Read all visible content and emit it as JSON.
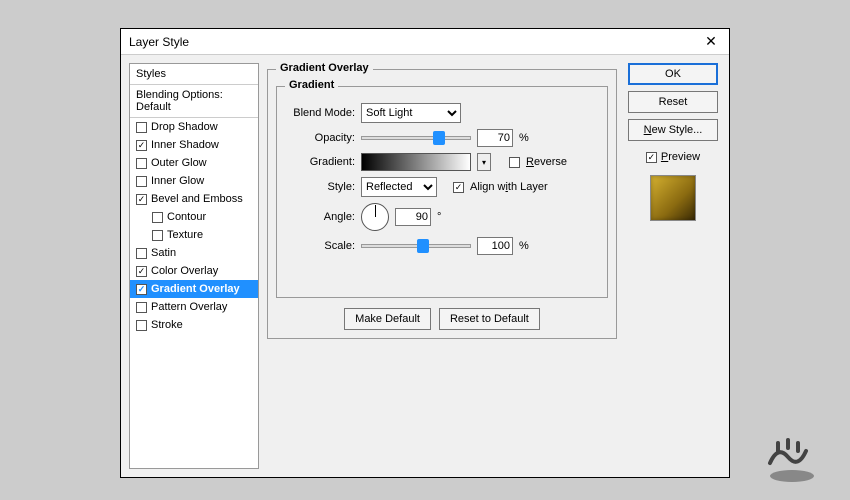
{
  "dialog": {
    "title": "Layer Style"
  },
  "styles": {
    "header": "Styles",
    "blending": "Blending Options: Default",
    "items": [
      {
        "label": "Drop Shadow",
        "checked": false
      },
      {
        "label": "Inner Shadow",
        "checked": true
      },
      {
        "label": "Outer Glow",
        "checked": false
      },
      {
        "label": "Inner Glow",
        "checked": false
      },
      {
        "label": "Bevel and Emboss",
        "checked": true
      },
      {
        "label": "Contour",
        "checked": false,
        "sub": true
      },
      {
        "label": "Texture",
        "checked": false,
        "sub": true
      },
      {
        "label": "Satin",
        "checked": false
      },
      {
        "label": "Color Overlay",
        "checked": true
      },
      {
        "label": "Gradient Overlay",
        "checked": true,
        "selected": true
      },
      {
        "label": "Pattern Overlay",
        "checked": false
      },
      {
        "label": "Stroke",
        "checked": false
      }
    ]
  },
  "gradient": {
    "group_title": "Gradient Overlay",
    "inner_title": "Gradient",
    "blend_mode_label": "Blend Mode:",
    "blend_mode_value": "Soft Light",
    "opacity_label": "Opacity:",
    "opacity_value": "70",
    "opacity_pct": 70,
    "percent": "%",
    "gradient_label": "Gradient:",
    "reverse_label": "Reverse",
    "reverse_checked": false,
    "style_label": "Style:",
    "style_value": "Reflected",
    "align_label": "Align with Layer",
    "align_checked": true,
    "angle_label": "Angle:",
    "angle_value": "90",
    "degree": "°",
    "scale_label": "Scale:",
    "scale_value": "100",
    "scale_pct": 55,
    "make_default": "Make Default",
    "reset_default": "Reset to Default"
  },
  "buttons": {
    "ok": "OK",
    "reset": "Reset",
    "new_style": "New Style...",
    "preview": "Preview",
    "preview_checked": true
  }
}
